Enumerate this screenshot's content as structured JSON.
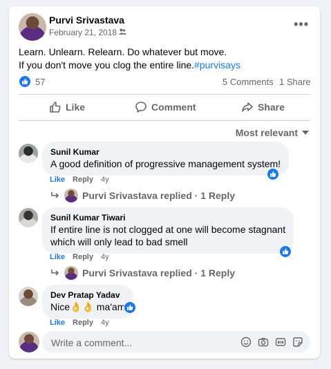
{
  "post": {
    "author": "Purvi Srivastava",
    "date": "February 21, 2018",
    "separator": "·",
    "text_line1": "Learn. Unlearn. Relearn. Do whatever but move.",
    "text_line2": "If you don't move you clog the entire line.",
    "hashtag": "#purvisays",
    "reaction_count": "57",
    "comments_count": "5 Comments",
    "shares_count": "1 Share",
    "icons": {
      "more": "more-options-icon",
      "audience": "friends-icon"
    }
  },
  "actions": {
    "like": "Like",
    "comment": "Comment",
    "share": "Share"
  },
  "sort": {
    "label": "Most relevant"
  },
  "comments": [
    {
      "name": "Sunil Kumar",
      "text": "A good definition of progressive management system!",
      "like": "Like",
      "reply": "Reply",
      "time": "4y",
      "reply_summary": "Purvi Srivastava replied · 1 Reply"
    },
    {
      "name": "Sunil Kumar Tiwari",
      "text_line1": "If entire line is not clogged at one will become stagnant",
      "text_line2": "which will only lead to bad smell",
      "like": "Like",
      "reply": "Reply",
      "time": "4y",
      "reply_summary": "Purvi Srivastava replied · 1 Reply"
    },
    {
      "name": "Dev Pratap Yadav",
      "text_prefix": "Nice",
      "text_suffix": " ma'am",
      "emoji": "👌",
      "like": "Like",
      "reply": "Reply",
      "time": "4y"
    }
  ],
  "composer": {
    "placeholder": "Write a comment..."
  },
  "colors": {
    "accent": "#1877f2",
    "secondary_text": "#65676b",
    "bubble": "#f0f2f5"
  }
}
